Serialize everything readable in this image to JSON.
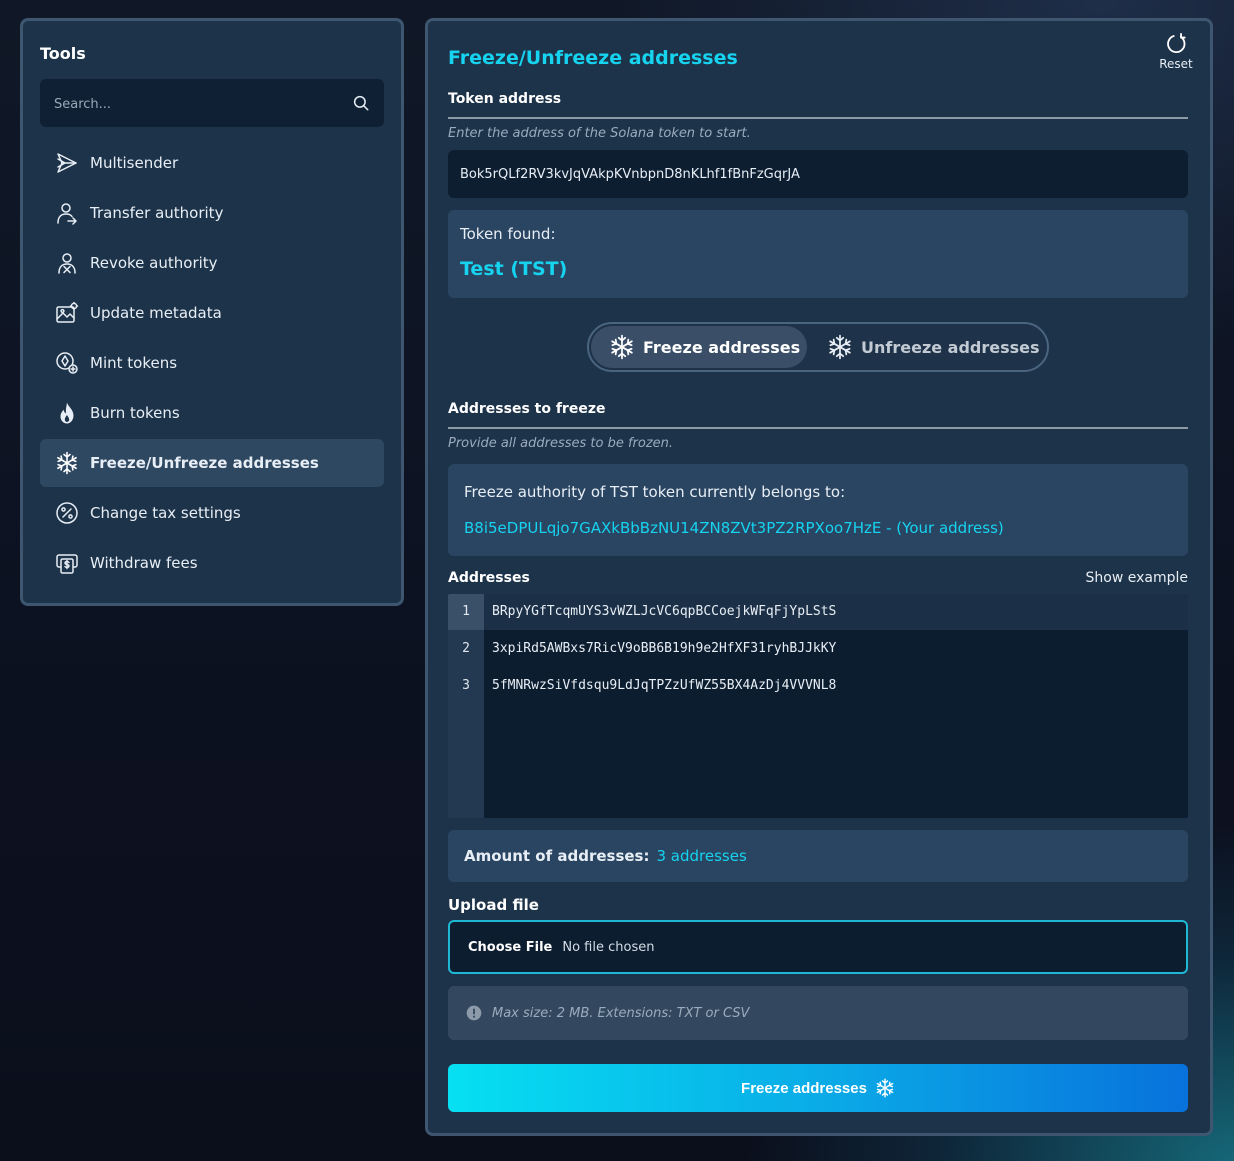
{
  "sidebar": {
    "title": "Tools",
    "search_placeholder": "Search...",
    "items": [
      {
        "label": "Multisender",
        "icon": "multisender-icon"
      },
      {
        "label": "Transfer authority",
        "icon": "transfer-authority-icon"
      },
      {
        "label": "Revoke authority",
        "icon": "revoke-authority-icon"
      },
      {
        "label": "Update metadata",
        "icon": "update-metadata-icon"
      },
      {
        "label": "Mint tokens",
        "icon": "mint-tokens-icon"
      },
      {
        "label": "Burn tokens",
        "icon": "flame-icon"
      },
      {
        "label": "Freeze/Unfreeze addresses",
        "icon": "snowflake-icon",
        "active": true
      },
      {
        "label": "Change tax settings",
        "icon": "percent-icon"
      },
      {
        "label": "Withdraw fees",
        "icon": "withdraw-fees-icon"
      }
    ]
  },
  "main": {
    "title": "Freeze/Unfreeze addresses",
    "reset_label": "Reset",
    "token_address_label": "Token address",
    "token_address_hint": "Enter the address of the Solana token to start.",
    "token_address_value": "Bok5rQLf2RV3kvJqVAkpKVnbpnD8nKLhf1fBnFzGqrJA",
    "token_found_label": "Token found:",
    "token_found_value": "Test (TST)",
    "toggle": {
      "freeze_label": "Freeze addresses",
      "unfreeze_label": "Unfreeze addresses",
      "selected": "freeze"
    },
    "addresses_to_freeze_label": "Addresses to freeze",
    "addresses_to_freeze_hint": "Provide all addresses to be frozen.",
    "authority_label": "Freeze authority of TST token currently belongs to:",
    "authority_value": "B8i5eDPULqjo7GAXkBbBzNU14ZN8ZVt3PZ2RPXoo7HzE - (Your address)",
    "addresses_label": "Addresses",
    "show_example_label": "Show example",
    "addresses": [
      {
        "num": "1",
        "value": "BRpyYGfTcqmUYS3vWZLJcVC6qpBCCoejkWFqFjYpLStS"
      },
      {
        "num": "2",
        "value": "3xpiRd5AWBxs7RicV9oBB6B19h9e2HfXF31ryhBJJkKY"
      },
      {
        "num": "3",
        "value": "5fMNRwzSiVfdsqu9LdJqTPZzUfWZ55BX4AzDj4VVVNL8"
      }
    ],
    "amount_label": "Amount of addresses:",
    "amount_value": "3 addresses",
    "upload_label": "Upload file",
    "choose_file_label": "Choose File",
    "file_status": "No file chosen",
    "file_info": "Max size: 2 MB. Extensions: TXT or CSV",
    "submit_label": "Freeze addresses"
  },
  "colors": {
    "accent": "#16d3ef",
    "panel": "#1d3349",
    "panel_border": "#3e566f"
  }
}
